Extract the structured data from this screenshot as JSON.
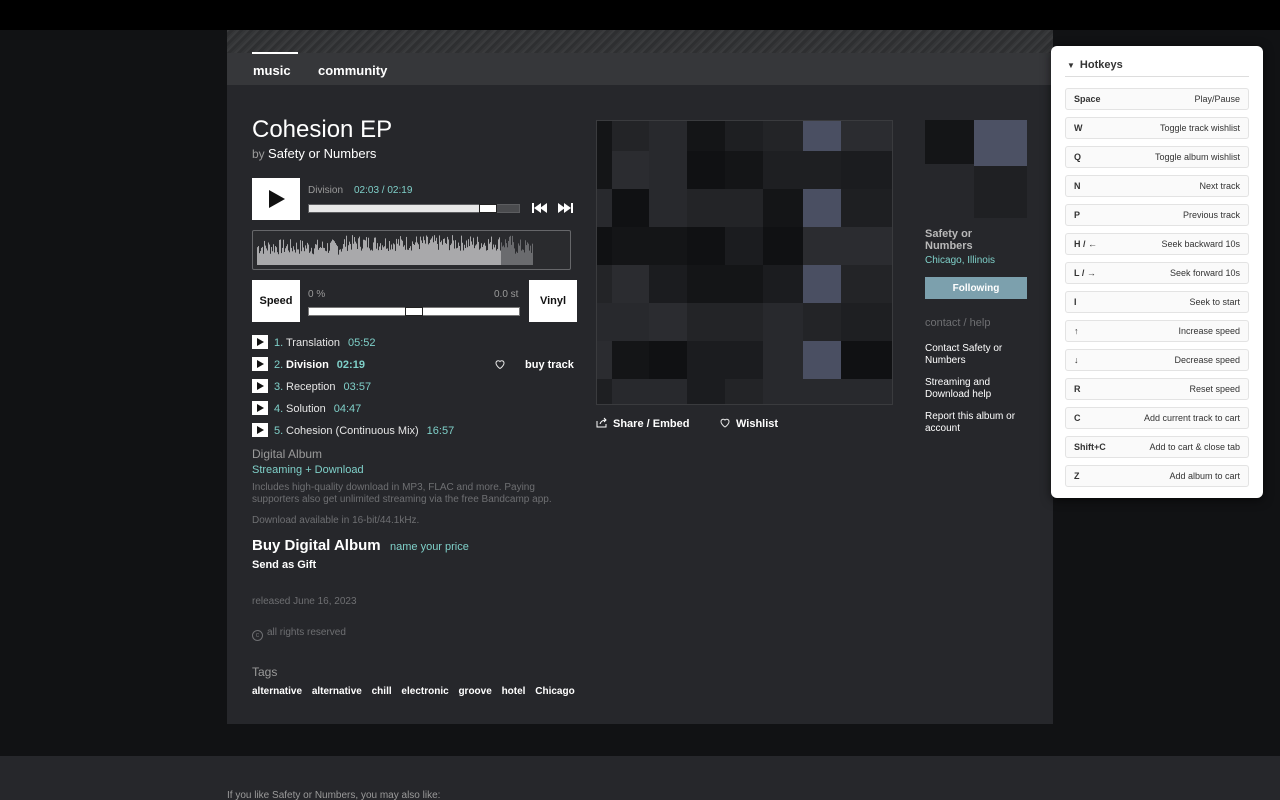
{
  "nav": {
    "tabs": [
      {
        "label": "music"
      },
      {
        "label": "community"
      }
    ]
  },
  "album": {
    "title": "Cohesion EP",
    "by_prefix": "by",
    "artist": "Safety or Numbers"
  },
  "player": {
    "track": "Division",
    "time": "02:03 / 02:19",
    "progress": 0.885,
    "speed_label": "Speed",
    "vinyl_label": "Vinyl",
    "speed_min": "0 %",
    "speed_max": "0.0 st",
    "speed_level": 0.5
  },
  "tracks": [
    {
      "num": "1.",
      "name": "Translation",
      "duration": "05:52",
      "active": false
    },
    {
      "num": "2.",
      "name": "Division",
      "duration": "02:19",
      "active": true
    },
    {
      "num": "3.",
      "name": "Reception",
      "duration": "03:57",
      "active": false
    },
    {
      "num": "4.",
      "name": "Solution",
      "duration": "04:47",
      "active": false
    },
    {
      "num": "5.",
      "name": "Cohesion (Continuous Mix)",
      "duration": "16:57",
      "active": false
    }
  ],
  "buy_track_label": "buy track",
  "digital": {
    "title": "Digital Album",
    "subtitle": "Streaming + Download",
    "description": "Includes high-quality download in MP3, FLAC and more. Paying supporters also get unlimited streaming via the free Bandcamp app.",
    "quality": "Download available in 16-bit/44.1kHz.",
    "buy_title": "Buy Digital Album",
    "buy_price": "name your price",
    "gift": "Send as Gift"
  },
  "released": "released June 16, 2023",
  "rights": "all rights reserved",
  "tags_heading": "Tags",
  "tags": [
    "alternative",
    "alternative",
    "chill",
    "electronic",
    "groove",
    "hotel",
    "Chicago"
  ],
  "actions": {
    "share": "Share / Embed",
    "wishlist": "Wishlist"
  },
  "artist": {
    "name": "Safety or Numbers",
    "location": "Chicago, Illinois",
    "follow_label": "Following",
    "contact_heading": "contact / help",
    "links": [
      "Contact Safety or Numbers",
      "Streaming and Download help",
      "Report this album or account"
    ]
  },
  "footer_text": "If you like Safety or Numbers, you may also like:",
  "hotkeys": {
    "title": "Hotkeys",
    "items": [
      {
        "key": "Space",
        "action": "Play/Pause"
      },
      {
        "key": "W",
        "action": "Toggle track wishlist"
      },
      {
        "key": "Q",
        "action": "Toggle album wishlist"
      },
      {
        "key": "N",
        "action": "Next track"
      },
      {
        "key": "P",
        "action": "Previous track"
      },
      {
        "key": "H / ←",
        "action": "Seek backward 10s"
      },
      {
        "key": "L / →",
        "action": "Seek forward 10s"
      },
      {
        "key": "I",
        "action": "Seek to start"
      },
      {
        "key": "↑",
        "action": "Increase speed"
      },
      {
        "key": "↓",
        "action": "Decrease speed"
      },
      {
        "key": "R",
        "action": "Reset speed"
      },
      {
        "key": "C",
        "action": "Add current track to cart"
      },
      {
        "key": "Shift+C",
        "action": "Add to cart & close tab"
      },
      {
        "key": "Z",
        "action": "Add album to cart"
      }
    ]
  },
  "colors": {
    "accent": "#7fd0c9",
    "follow": "#7ca0ad",
    "page_bg": "#26272b"
  }
}
